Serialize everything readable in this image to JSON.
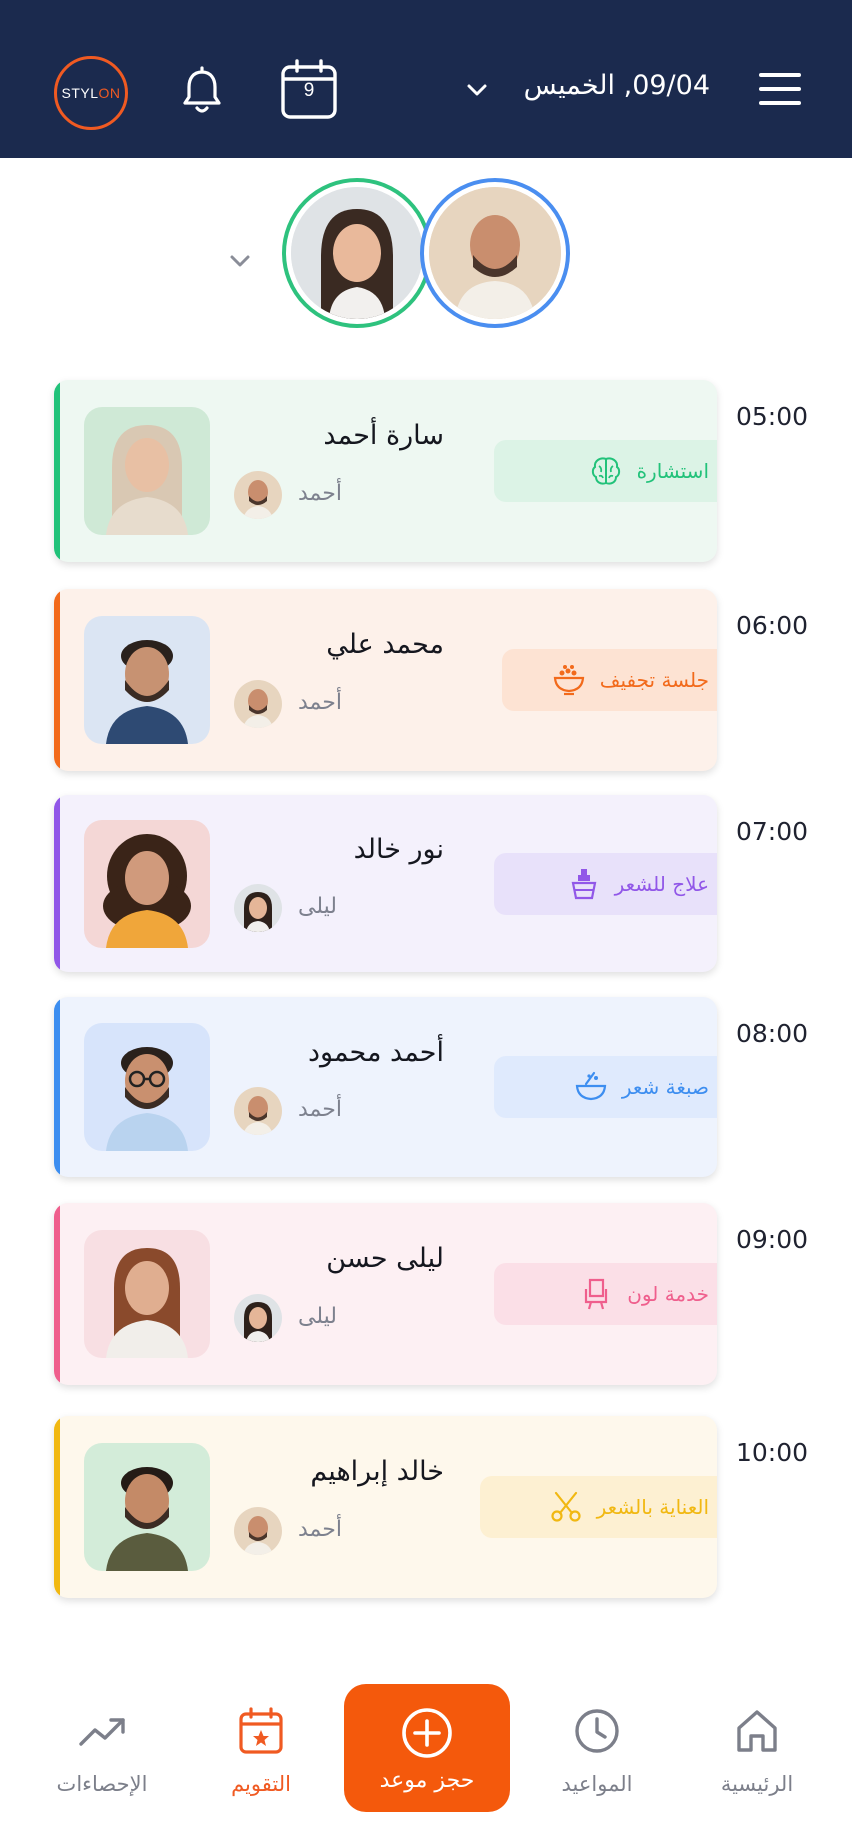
{
  "header": {
    "logo_left": "STYL",
    "logo_right": "ON",
    "calendar_day": "9",
    "date": "09/04, الخميس"
  },
  "appointments": [
    {
      "time": "05:00",
      "client": "سارة أحمد",
      "staff": "أحمد",
      "service": "استشارة",
      "color": "#22c27a",
      "bg": "#eef8f2",
      "tag_bg": "#dcf3e6",
      "icon": "brain-icon"
    },
    {
      "time": "06:00",
      "client": "محمد علي",
      "staff": "أحمد",
      "service": "جلسة تجفيف",
      "color": "#f26a1b",
      "bg": "#fdf1ea",
      "tag_bg": "#fde3d3",
      "icon": "bowl-icon"
    },
    {
      "time": "07:00",
      "client": "نور خالد",
      "staff": "ليلى",
      "service": "علاج للشعر",
      "color": "#9157e8",
      "bg": "#f4f1fc",
      "tag_bg": "#e8e1fa",
      "icon": "treatment-bottle-icon"
    },
    {
      "time": "08:00",
      "client": "أحمد محمود",
      "staff": "أحمد",
      "service": "صبغة شعر",
      "color": "#3d8ef0",
      "bg": "#eef3fd",
      "tag_bg": "#dfeafd",
      "icon": "dye-bowl-icon"
    },
    {
      "time": "09:00",
      "client": "ليلى حسن",
      "staff": "ليلى",
      "service": "خدمة لون",
      "color": "#ef5f8d",
      "bg": "#fdf0f3",
      "tag_bg": "#fbdfe7",
      "icon": "chair-icon"
    },
    {
      "time": "10:00",
      "client": "خالد إبراهيم",
      "staff": "أحمد",
      "service": "العناية بالشعر",
      "color": "#f1b812",
      "bg": "#fef8ec",
      "tag_bg": "#fdf0d2",
      "icon": "scissors-icon"
    }
  ],
  "nav": {
    "stats": "الإحصاءات",
    "calendar": "التقويم",
    "book": "حجز موعد",
    "appointments": "المواعيد",
    "home": "الرئيسية"
  },
  "colors": {
    "header_bg": "#1b2a4e",
    "accent": "#f4590c"
  }
}
